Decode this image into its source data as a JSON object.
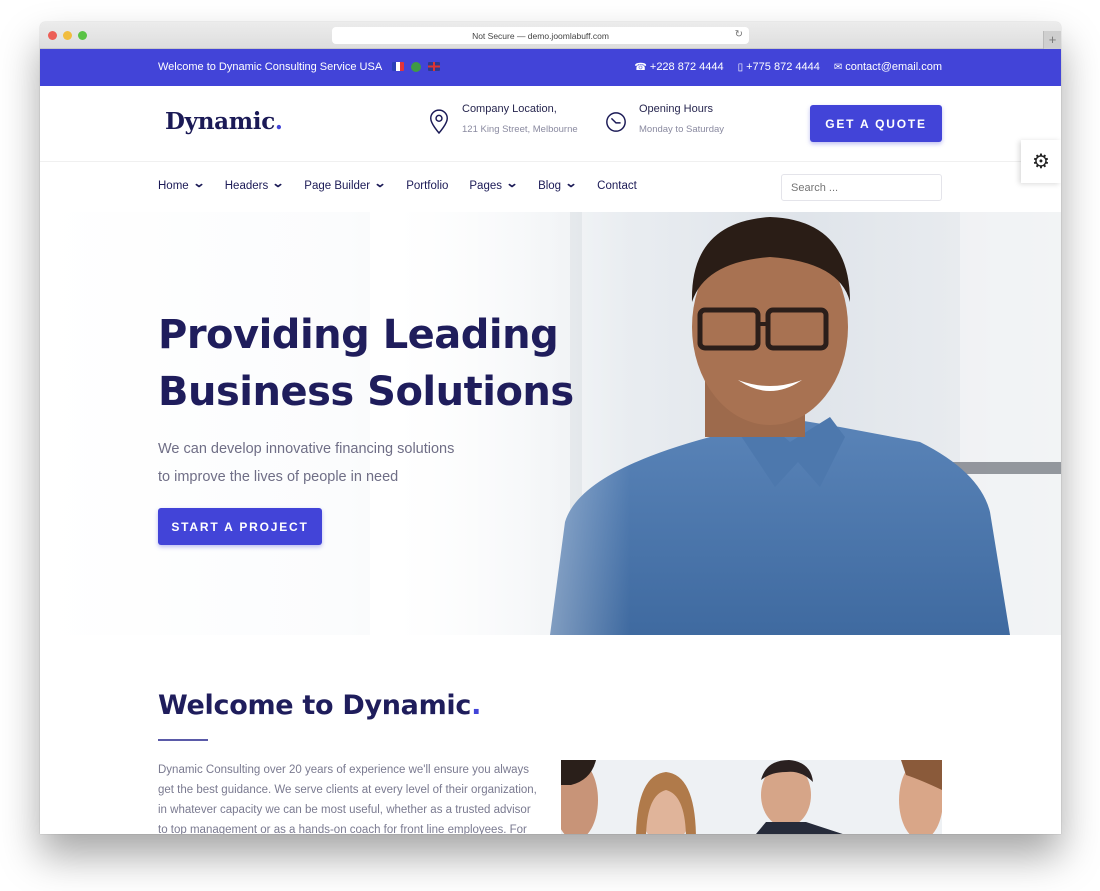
{
  "browser": {
    "url_text": "Not Secure — demo.joomlabuff.com",
    "new_tab_icon": "+",
    "reload_icon": "reload-icon"
  },
  "topbar": {
    "welcome": "Welcome to Dynamic Consulting Service USA",
    "flags": [
      "france",
      "saudi-arabia",
      "united-kingdom"
    ],
    "phone": "+228 872 4444",
    "mobile": "+775 872 4444",
    "email": "contact@email.com",
    "phone_icon": "☎",
    "mobile_icon": "▯",
    "email_icon": "✉",
    "bg_color": "#4244d8"
  },
  "header": {
    "logo": "Dynamic",
    "logo_dot": ".",
    "location_title": "Company Location,",
    "location_sub": "121 King Street, Melbourne",
    "hours_title": "Opening Hours",
    "hours_sub": "Monday to Saturday",
    "quote_button": "GET A QUOTE"
  },
  "nav": {
    "items": [
      {
        "label": "Home",
        "dropdown": true
      },
      {
        "label": "Headers",
        "dropdown": true
      },
      {
        "label": "Page Builder",
        "dropdown": true
      },
      {
        "label": "Portfolio",
        "dropdown": false
      },
      {
        "label": "Pages",
        "dropdown": true
      },
      {
        "label": "Blog",
        "dropdown": true
      },
      {
        "label": "Contact",
        "dropdown": false
      }
    ],
    "chevron": "⌄",
    "search_placeholder": "Search ...",
    "settings_icon": "⚙"
  },
  "hero": {
    "title_line1": "Providing Leading",
    "title_line2": "Business Solutions",
    "sub_line1": "We can develop innovative financing solutions",
    "sub_line2": "to improve the lives of people in need",
    "button": "START A PROJECT"
  },
  "welcome": {
    "title": "Welcome to Dynamic",
    "title_dot": ".",
    "body": "Dynamic Consulting over 20 years of experience we'll ensure you always get the best guidance. We serve clients at every level of their organization, in whatever capacity we can be most useful, whether as a trusted advisor to top management or as a hands-on coach for front line employees. For every"
  },
  "colors": {
    "accent": "#4244d8",
    "heading": "#1f1d5c",
    "muted_text": "#7a7a90"
  }
}
